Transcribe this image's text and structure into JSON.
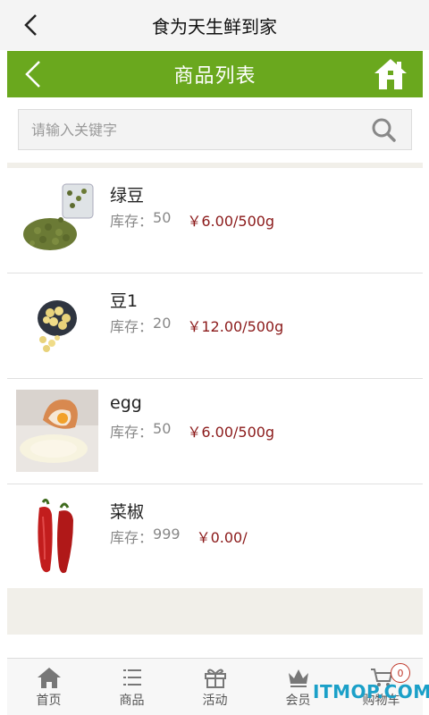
{
  "header": {
    "title": "食为天生鲜到家"
  },
  "nav": {
    "title": "商品列表"
  },
  "search": {
    "placeholder": "请输入关键字"
  },
  "products": [
    {
      "name": "绿豆",
      "stock_label": "库存：",
      "stock": "50",
      "price": "￥6.00/500g"
    },
    {
      "name": "豆1",
      "stock_label": "库存：",
      "stock": "20",
      "price": "￥12.00/500g"
    },
    {
      "name": "egg",
      "stock_label": "库存：",
      "stock": "50",
      "price": "￥6.00/500g"
    },
    {
      "name": "菜椒",
      "stock_label": "库存：",
      "stock": "999",
      "price": "￥0.00/"
    }
  ],
  "tabs": [
    {
      "label": "首页",
      "icon": "home-icon"
    },
    {
      "label": "商品",
      "icon": "list-icon"
    },
    {
      "label": "活动",
      "icon": "gift-icon"
    },
    {
      "label": "会员",
      "icon": "crown-icon"
    },
    {
      "label": "购物车",
      "icon": "cart-icon"
    }
  ],
  "cart_count": "0",
  "watermark": "ITMOP.COM",
  "colors": {
    "brand_green": "#6aa81e",
    "price_red": "#8b1a1a",
    "watermark_blue": "#1ba0c8"
  }
}
